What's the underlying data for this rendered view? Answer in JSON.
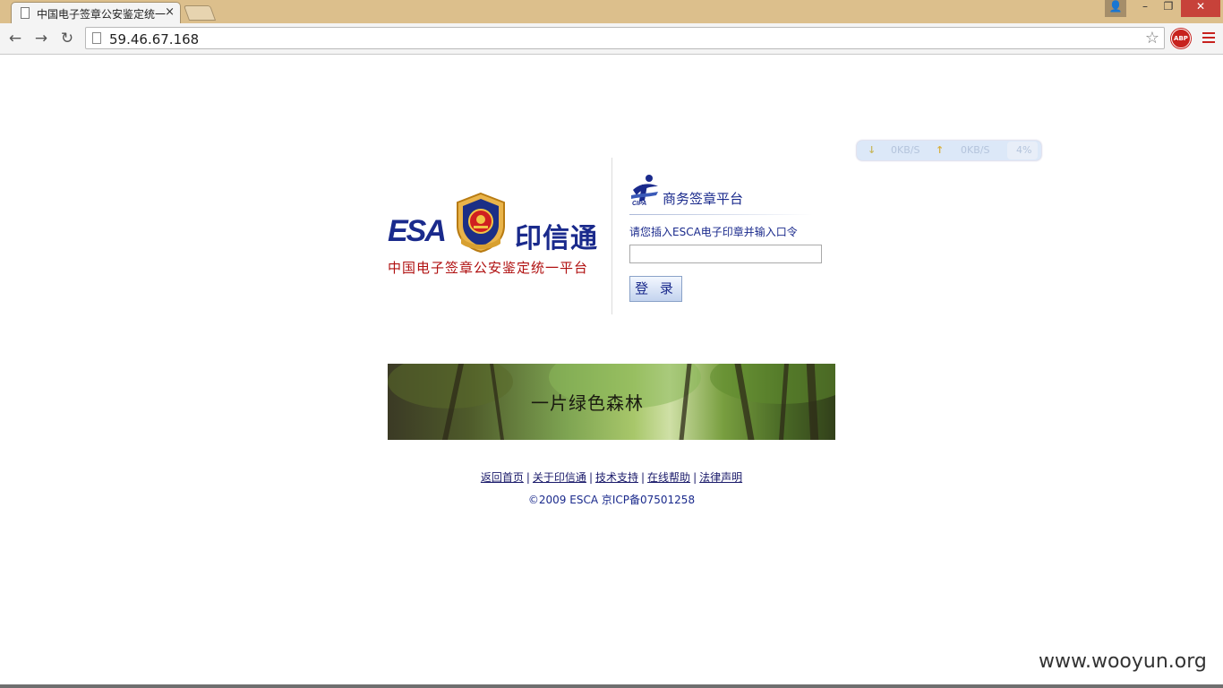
{
  "browser": {
    "tab_title": "中国电子签章公安鉴定统一",
    "tab_close": "×",
    "address": "59.46.67.168",
    "nav": {
      "back": "←",
      "forward": "→",
      "reload": "↻"
    },
    "star": "☆",
    "abp_label": "ABP",
    "window_buttons": {
      "minimize": "–",
      "maximize": "❐",
      "close": "✕",
      "user": "👤"
    }
  },
  "speed_widget": {
    "down": "0KB/S",
    "up": "0KB/S",
    "percent": "4%"
  },
  "logo": {
    "esa_text": "ESA",
    "brand_text": "印信通",
    "subtitle": "中国电子签章公安鉴定统一平台"
  },
  "platform": {
    "title": "商务签章平台",
    "prompt": "请您插入ESCA电子印章并输入口令",
    "password_value": "",
    "login_label": "登 录"
  },
  "banner": {
    "text": "一片绿色森林"
  },
  "footer": {
    "links": [
      "返回首页",
      "关于印信通",
      "技术支持",
      "在线帮助",
      "法律声明"
    ],
    "copyright": "©2009 ESCA   京ICP备07501258"
  },
  "watermark": "www.wooyun.org",
  "colors": {
    "brand_blue": "#1a2a8c",
    "brand_red": "#b01010",
    "titlebar": "#dcbf8c"
  }
}
